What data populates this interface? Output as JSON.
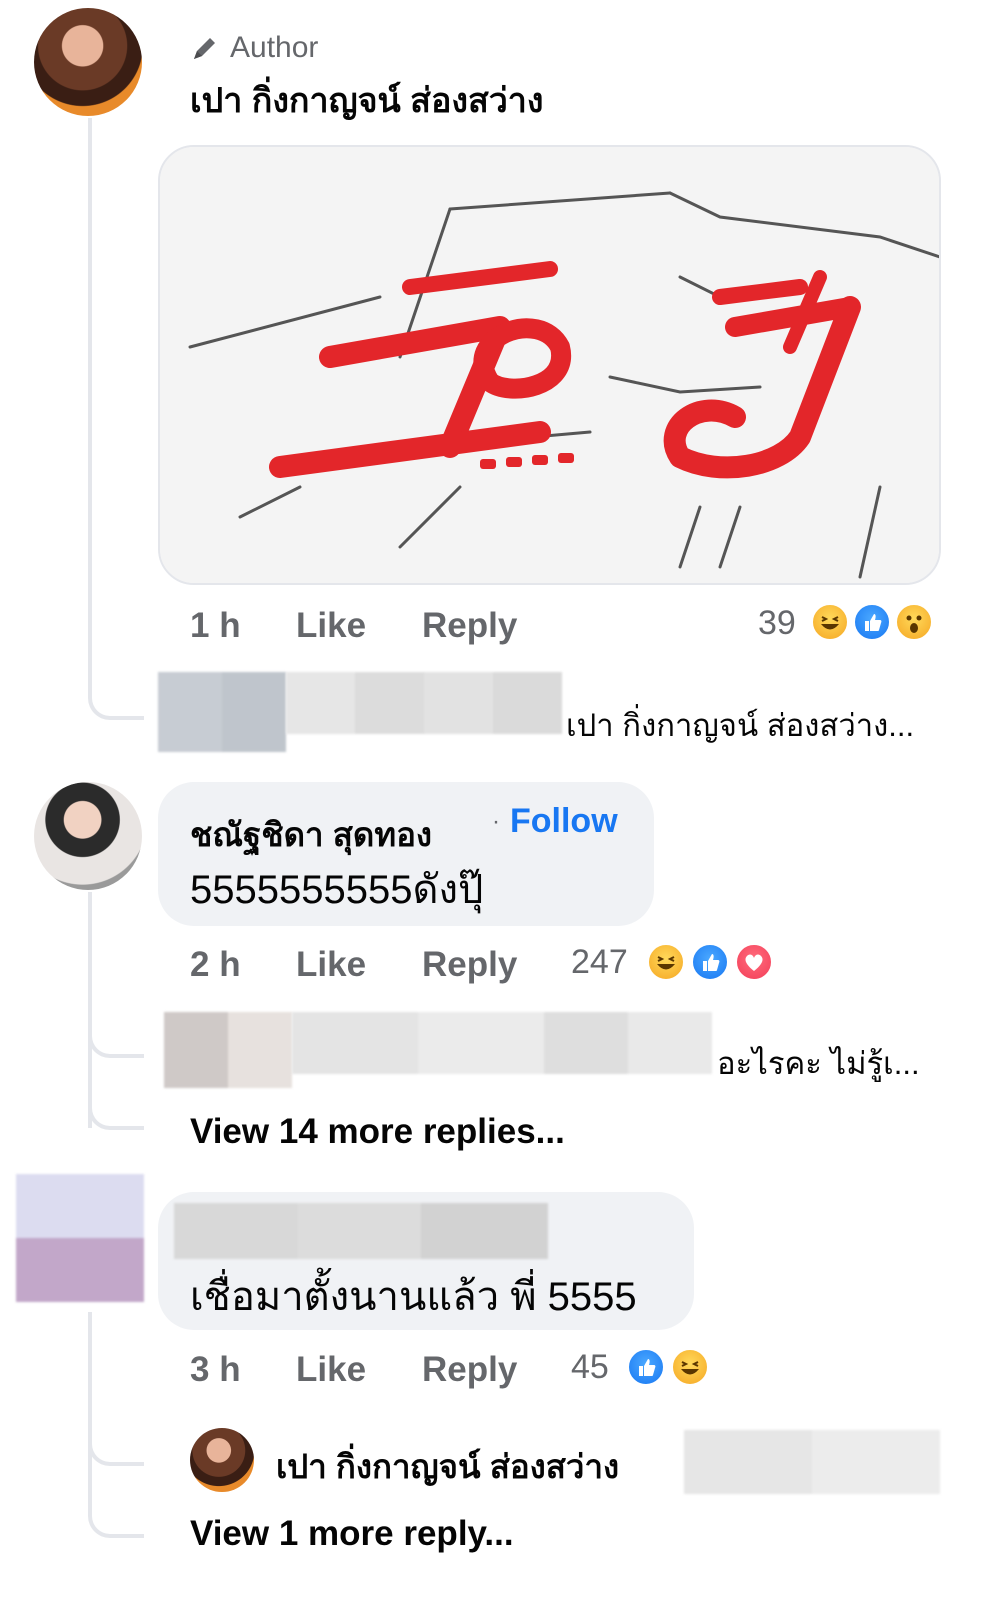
{
  "comment1": {
    "author_badge": "Author",
    "author_name": "เปา กิ่งกาญจน์ ส่องสว่าง",
    "time": "1 h",
    "like_label": "Like",
    "reply_label": "Reply",
    "reaction_count": "39",
    "reactions": [
      "laugh",
      "like",
      "wow"
    ],
    "reply_preview_text": "เปา กิ่งกาญจน์ ส่องสว่าง..."
  },
  "comment2": {
    "author_name": "ชณัฐชิดา สุดทอง",
    "follow_label": "Follow",
    "text": "5555555555ดังปุ๊",
    "time": "2 h",
    "like_label": "Like",
    "reply_label": "Reply",
    "reaction_count": "247",
    "reactions": [
      "laugh",
      "like",
      "love"
    ],
    "reply_preview_text": "อะไรคะ ไม่รู้เ...",
    "view_more": "View 14 more replies..."
  },
  "comment3": {
    "text": "เชื่อมาตั้งนานแล้ว พี่ 5555",
    "time": "3 h",
    "like_label": "Like",
    "reply_label": "Reply",
    "reaction_count": "45",
    "reactions": [
      "like",
      "laugh"
    ],
    "reply_author_name": "เปา กิ่งกาญจน์ ส่องสว่าง",
    "view_more": "View 1 more reply..."
  },
  "colors": {
    "link_blue": "#1877f2",
    "meta_gray": "#65676b",
    "bubble_bg": "#f0f2f5",
    "sticker_red": "#e3262a"
  }
}
